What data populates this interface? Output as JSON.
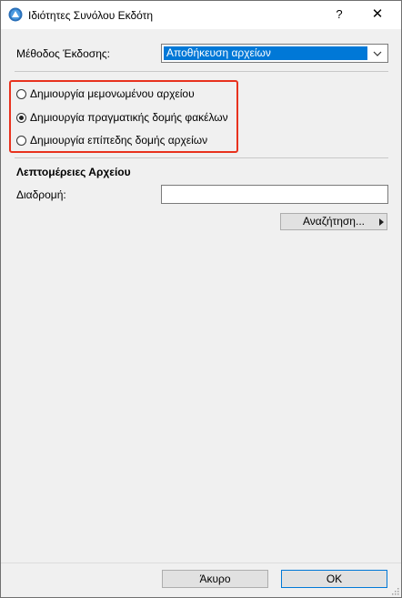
{
  "window": {
    "title": "Ιδιότητες Συνόλου Εκδότη",
    "help_label": "?",
    "close_label": "✕",
    "icon": "archicad-icon"
  },
  "method": {
    "label": "Μέθοδος Έκδοσης:",
    "selected": "Αποθήκευση αρχείων"
  },
  "radios": [
    {
      "label": "Δημιουργία μεμονωμένου αρχείου",
      "checked": false
    },
    {
      "label": "Δημιουργία πραγματικής δομής φακέλων",
      "checked": true
    },
    {
      "label": "Δημιουργία επίπεδης δομής αρχείων",
      "checked": false
    }
  ],
  "details": {
    "title": "Λεπτομέρειες Αρχείου",
    "path_label": "Διαδρομή:",
    "path_value": "",
    "browse_label": "Αναζήτηση..."
  },
  "footer": {
    "cancel_label": "Άκυρο",
    "ok_label": "OK"
  },
  "colors": {
    "highlight": "#e8321e",
    "selection": "#0078d7"
  }
}
